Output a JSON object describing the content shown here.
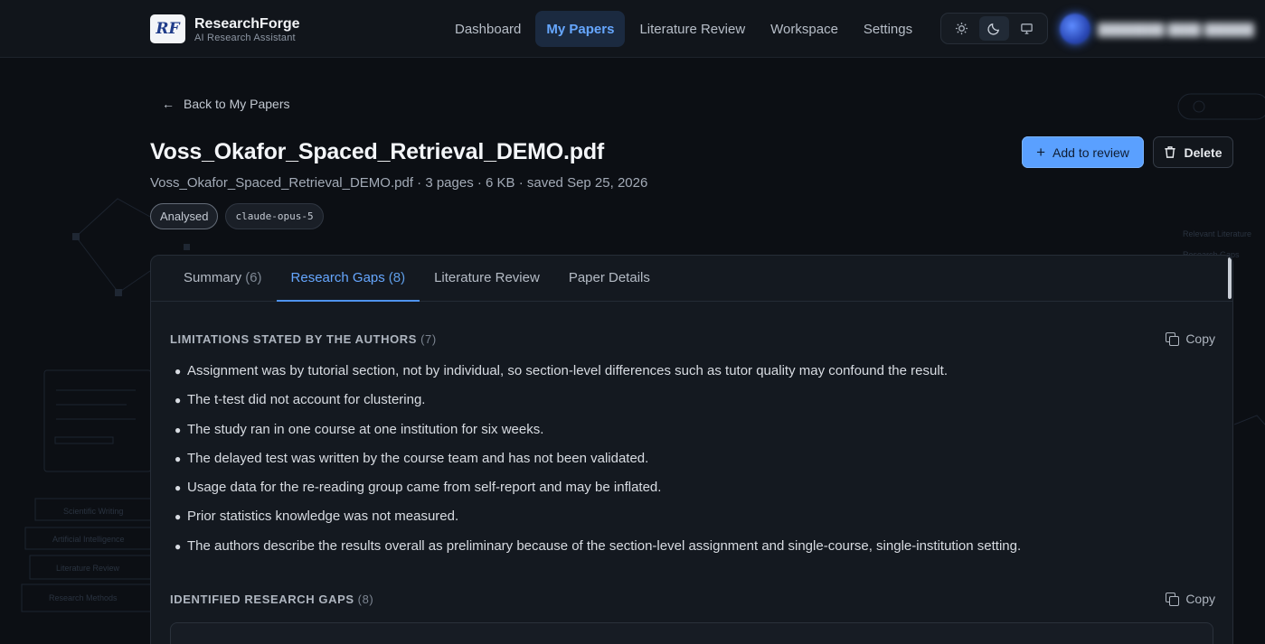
{
  "app": {
    "name": "ResearchForge",
    "subtitle": "AI Research Assistant",
    "logo_text": "RF"
  },
  "nav": {
    "items": [
      {
        "label": "Dashboard",
        "active": false
      },
      {
        "label": "My Papers",
        "active": true
      },
      {
        "label": "Literature Review",
        "active": false
      },
      {
        "label": "Workspace",
        "active": false
      },
      {
        "label": "Settings",
        "active": false
      }
    ]
  },
  "theme_switch": {
    "options": [
      "sun-icon",
      "moon-icon",
      "monitor-icon"
    ],
    "selected": "moon-icon"
  },
  "back_link": "Back to My Papers",
  "paper": {
    "title": "Voss_Okafor_Spaced_Retrieval_DEMO.pdf",
    "meta": "Voss_Okafor_Spaced_Retrieval_DEMO.pdf · 3 pages · 6 KB · saved Sep 25, 2026",
    "status_badge": "Analysed",
    "model_badge": "claude-opus-5"
  },
  "actions": {
    "add_label": "Add to review",
    "delete_label": "Delete"
  },
  "tabs": [
    {
      "label": "Summary",
      "count": "(6)",
      "active": false
    },
    {
      "label": "Research Gaps",
      "count": "(8)",
      "active": true
    },
    {
      "label": "Literature Review",
      "count": "",
      "active": false
    },
    {
      "label": "Paper Details",
      "count": "",
      "active": false
    }
  ],
  "limitations": {
    "title": "Limitations stated by the authors",
    "count": "(7)",
    "copy_label": "Copy",
    "items": [
      "Assignment was by tutorial section, not by individual, so section-level differences such as tutor quality may confound the result.",
      "The t-test did not account for clustering.",
      "The study ran in one course at one institution for six weeks.",
      "The delayed test was written by the course team and has not been validated.",
      "Usage data for the re-reading group came from self-report and may be inflated.",
      "Prior statistics knowledge was not measured.",
      "The authors describe the results overall as preliminary because of the section-level assignment and single-course, single-institution setting."
    ]
  },
  "gaps": {
    "title": "Identified research gaps",
    "count": "(8)",
    "copy_label": "Copy"
  },
  "colors": {
    "accent": "#66a7ff",
    "primary_button": "#5aa0ff",
    "background": "#0c0f14"
  }
}
